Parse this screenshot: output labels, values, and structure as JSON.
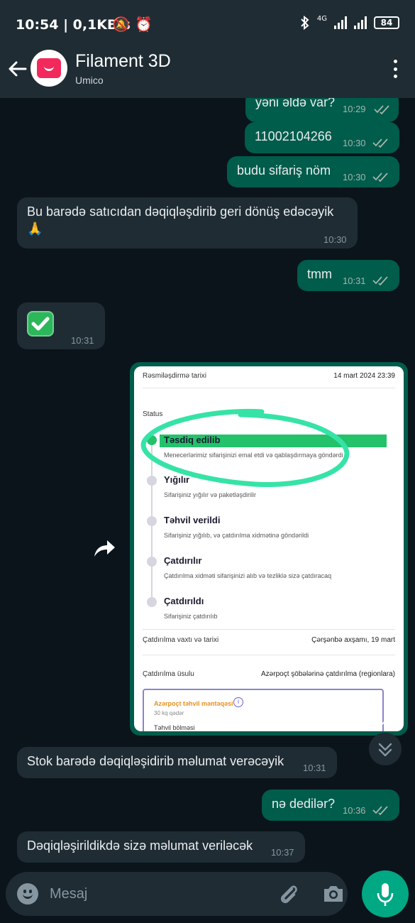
{
  "status_bar": {
    "time_speed": "10:54 | 0,1KB/s",
    "network_type": "4G",
    "battery": "84",
    "icons": [
      "mute-icon",
      "alarm-icon",
      "bluetooth-icon",
      "signal-icon",
      "battery-icon"
    ]
  },
  "header": {
    "title": "Filament 3D",
    "subtitle": "Umico",
    "icons": [
      "back-arrow-icon",
      "umico-logo-icon",
      "more-vert-icon"
    ]
  },
  "messages": [
    {
      "dir": "out",
      "text": "yəni əldə var?",
      "time": "10:29"
    },
    {
      "dir": "out",
      "text": "11002104266",
      "time": "10:30"
    },
    {
      "dir": "out",
      "text": "budu sifariş nöm",
      "time": "10:30"
    },
    {
      "dir": "in",
      "text": "Bu barədə satıcıdan dəqiqləşdirib geri dönüş edəcəyik",
      "emoji": "🙏",
      "time": "10:30"
    },
    {
      "dir": "out",
      "text": "tmm",
      "time": "10:31"
    },
    {
      "dir": "in",
      "emoji": "✅",
      "time": "10:31"
    },
    {
      "dir": "out",
      "type": "image",
      "time": "10:31"
    },
    {
      "dir": "in",
      "text": "Stok barədə dəqiqləşidirib məlumat verəcəyik",
      "time": "10:31"
    },
    {
      "dir": "out",
      "text": "nə dedilər?",
      "time": "10:36"
    },
    {
      "dir": "in",
      "text": "Dəqiqləşirildikdə sizə məlumat veriləcək",
      "time": "10:37"
    }
  ],
  "order_screenshot": {
    "date_label": "Rəsmiləşdirmə tarixi",
    "date_value": "14 mart 2024 23:39",
    "status_label": "Status",
    "steps": [
      {
        "title": "Təsdiq edilib",
        "desc": "Menecerlərimiz sifarişinizi emal etdi və qablaşdırmaya göndərdi"
      },
      {
        "title": "Yığılır",
        "desc": "Sifarişiniz yığılır və paketləşdirilir"
      },
      {
        "title": "Təhvil verildi",
        "desc": "Sifarişiniz yığılıb, və çatdırılma xidmətinə göndərildi"
      },
      {
        "title": "Çatdırılır",
        "desc": "Çatdırılma xidməti sifarişinizi alıb və tezliklə sizə çatdıracaq"
      },
      {
        "title": "Çatdırıldı",
        "desc": "Sifarişiniz çatdırılıb"
      }
    ],
    "delivery_time_label": "Çatdırılma vaxtı və tarixi",
    "delivery_time_value": "Çərşənbə axşamı, 19 mart",
    "delivery_method_label": "Çatdırılma üsulu",
    "delivery_method_value": "Azərpoçt şöbələrinə çatdırılma (regionlara)",
    "zone_title": "Azərpoçt təhvil məntəqəsi",
    "zone_weight": "30 kq qədər",
    "zone_sub": "Təhvil bölməsi"
  },
  "input": {
    "placeholder": "Mesaj",
    "icons": [
      "emoji-icon",
      "attach-icon",
      "camera-icon",
      "mic-icon",
      "scroll-down-icon"
    ]
  },
  "colors": {
    "outgoing": "#005c4b",
    "incoming": "#1f2c34",
    "background": "#0b141a",
    "accent": "#00a884",
    "highlight": "#23c26b"
  }
}
